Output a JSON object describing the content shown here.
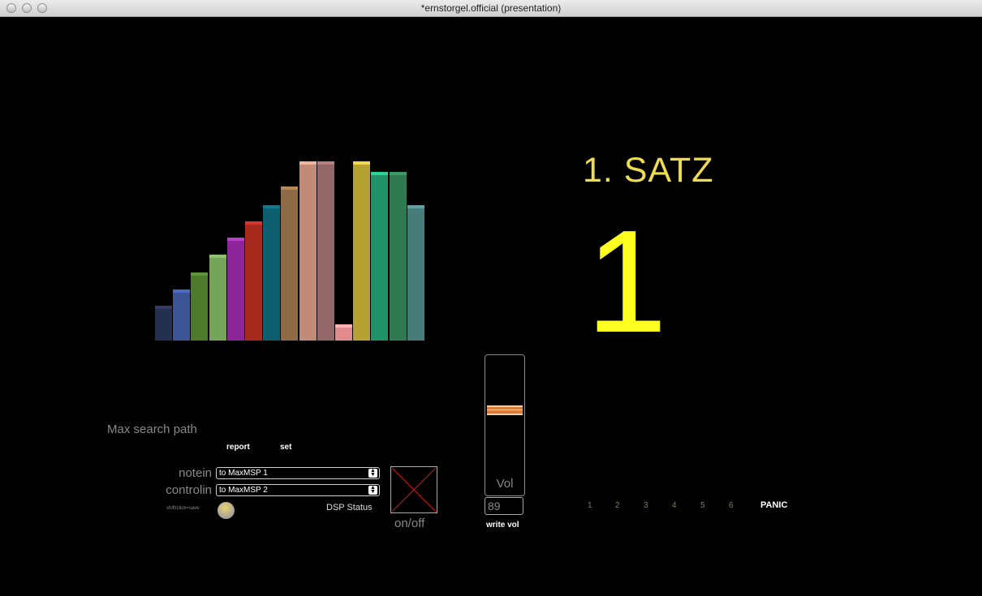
{
  "window": {
    "title": "*ernstorgel.official (presentation)"
  },
  "registers": {
    "levels": [
      0.19,
      0.28,
      0.37,
      0.47,
      0.56,
      0.65,
      0.74,
      0.84,
      0.98,
      0.98,
      0.09,
      0.98,
      0.92,
      0.92,
      0.74
    ],
    "colors": [
      "#24304f",
      "#3c5597",
      "#4d7a2a",
      "#77a45b",
      "#8e2599",
      "#a62a1d",
      "#0d5e6f",
      "#8f6a47",
      "#c18b77",
      "#936667",
      "#e28b8e",
      "#b5a232",
      "#1f9268",
      "#2f7a51",
      "#4a7b7b"
    ],
    "cap_colors": [
      "#303d63",
      "#4c6cc3",
      "#5c963a",
      "#8fc16e",
      "#b741c4",
      "#d2382b",
      "#137a8f",
      "#b88a5c",
      "#f0b59b",
      "#b87f80",
      "#ffb3b6",
      "#f0d84a",
      "#2bd29a",
      "#3c9a68",
      "#5fa0a0"
    ]
  },
  "movement": {
    "title": "1. SATZ",
    "number": "1"
  },
  "search_path": {
    "label": "Max search path",
    "report_label": "report",
    "set_label": "set"
  },
  "midi": {
    "notein_label": "notein",
    "notein_value": "to MaxMSP 1",
    "controlin_label": "controlin",
    "controlin_value": "to MaxMSP 2"
  },
  "shift_hint": "shift/click=save",
  "dsp": {
    "status_label": "DSP Status",
    "toggle_label": "on/off"
  },
  "volume": {
    "label": "Vol",
    "value": "89",
    "level": 0.6,
    "write_label": "write vol"
  },
  "presets": [
    "1",
    "2",
    "3",
    "4",
    "5",
    "6"
  ],
  "panic_label": "PANIC"
}
